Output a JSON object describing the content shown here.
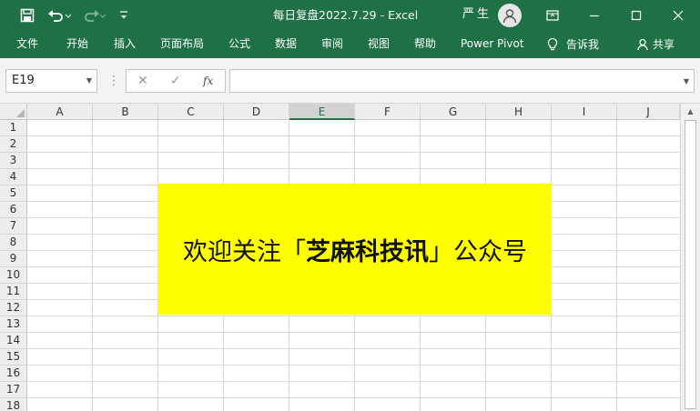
{
  "window": {
    "title": "每日复盘2022.7.29  -  Excel",
    "user": "严生",
    "accent": "#1e7145"
  },
  "quick_access": {
    "icons": [
      "save-icon",
      "undo-icon",
      "redo-icon",
      "customize-icon"
    ]
  },
  "ribbon": {
    "tabs": [
      "文件",
      "开始",
      "插入",
      "页面布局",
      "公式",
      "数据",
      "审阅",
      "视图",
      "帮助",
      "Power Pivot"
    ],
    "tell_me": "告诉我",
    "share": "共享"
  },
  "formula_bar": {
    "name_box": "E19",
    "formula_value": "",
    "fx_label": "fx"
  },
  "sheet": {
    "columns": [
      "A",
      "B",
      "C",
      "D",
      "E",
      "F",
      "G",
      "H",
      "I",
      "J"
    ],
    "selected_column": "E",
    "rows": [
      "1",
      "2",
      "3",
      "4",
      "5",
      "6",
      "7",
      "8",
      "9",
      "10",
      "11",
      "12",
      "13",
      "14",
      "15",
      "16",
      "17",
      "18"
    ]
  },
  "banner": {
    "prefix": "欢迎关注「",
    "name": "芝麻科技讯",
    "suffix": "」公众号",
    "background": "#ffff00"
  }
}
